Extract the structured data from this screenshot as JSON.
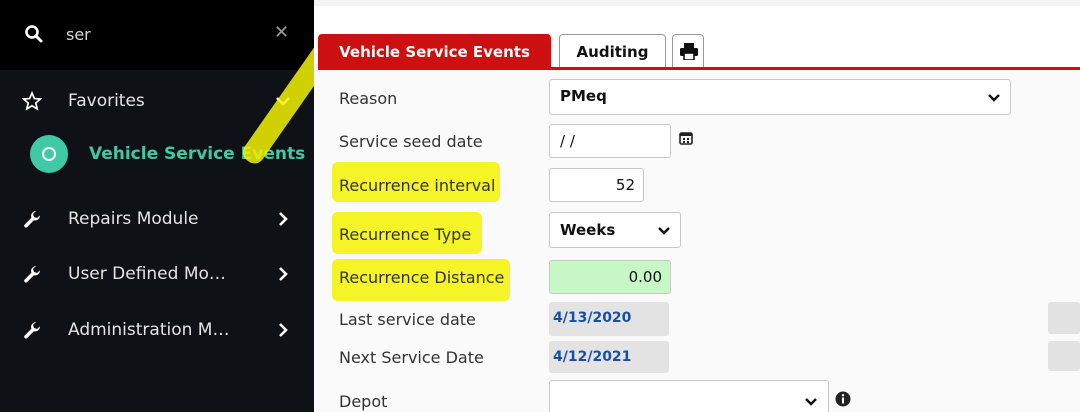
{
  "sidebar": {
    "search": {
      "value": "ser",
      "close_icon": "close-icon",
      "search_icon": "search-icon"
    },
    "items": [
      {
        "label": "Favorites",
        "icon": "star-outline-icon",
        "chevron": "chevron-down-icon"
      },
      {
        "label": "Vehicle Service Events",
        "icon": "circle-icon",
        "active": true
      },
      {
        "label": "Repairs Module",
        "icon": "wrench-icon",
        "chevron": "chevron-right-icon"
      },
      {
        "label": "User Defined Mo…",
        "icon": "wrench-icon",
        "chevron": "chevron-right-icon"
      },
      {
        "label": "Administration M…",
        "icon": "wrench-icon",
        "chevron": "chevron-right-icon"
      }
    ],
    "accent_color": "#3fcaa5"
  },
  "tabs": [
    {
      "label": "Vehicle Service Events",
      "active": true
    },
    {
      "label": "Auditing"
    },
    {
      "icon": "print-icon"
    }
  ],
  "tab_accent_color": "#cc0f10",
  "form": {
    "reason": {
      "label": "Reason",
      "value": "PMeq"
    },
    "service_seed_date": {
      "label": "Service seed date",
      "value": "/ /"
    },
    "recurrence_interval": {
      "label": "Recurrence interval",
      "value": "52"
    },
    "recurrence_type": {
      "label": "Recurrence Type",
      "value": "Weeks"
    },
    "recurrence_distance": {
      "label": "Recurrence Distance",
      "value": "0.00"
    },
    "last_service_date": {
      "label": "Last service date",
      "value": "4/13/2020"
    },
    "next_service_date": {
      "label": "Next Service Date",
      "value": "4/12/2021"
    },
    "depot": {
      "label": "Depot",
      "value": ""
    }
  },
  "highlight_color": "#f2f200"
}
